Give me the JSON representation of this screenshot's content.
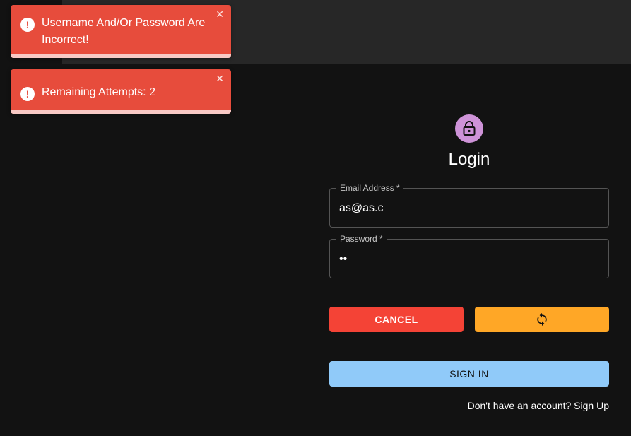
{
  "toasts": [
    {
      "message": "Username And/Or Password Are Incorrect!",
      "icon": "exclamation-circle-icon",
      "close": "✕"
    },
    {
      "message": "Remaining Attempts: 2",
      "icon": "exclamation-circle-icon",
      "close": "✕"
    }
  ],
  "login": {
    "avatar_icon": "lock-icon",
    "title": "Login",
    "email": {
      "label": "Email Address *",
      "value": "as@as.c"
    },
    "password": {
      "label": "Password *",
      "value": "as"
    },
    "cancel_label": "CANCEL",
    "reset_icon": "refresh-icon",
    "signin_label": "SIGN IN",
    "signup_text": "Don't have an account? Sign Up"
  },
  "colors": {
    "background": "#121212",
    "topbar": "#272727",
    "toast_error": "#e74c3c",
    "avatar": "#ce93d8",
    "cancel": "#f44336",
    "reset": "#ffa726",
    "signin": "#90caf9"
  }
}
